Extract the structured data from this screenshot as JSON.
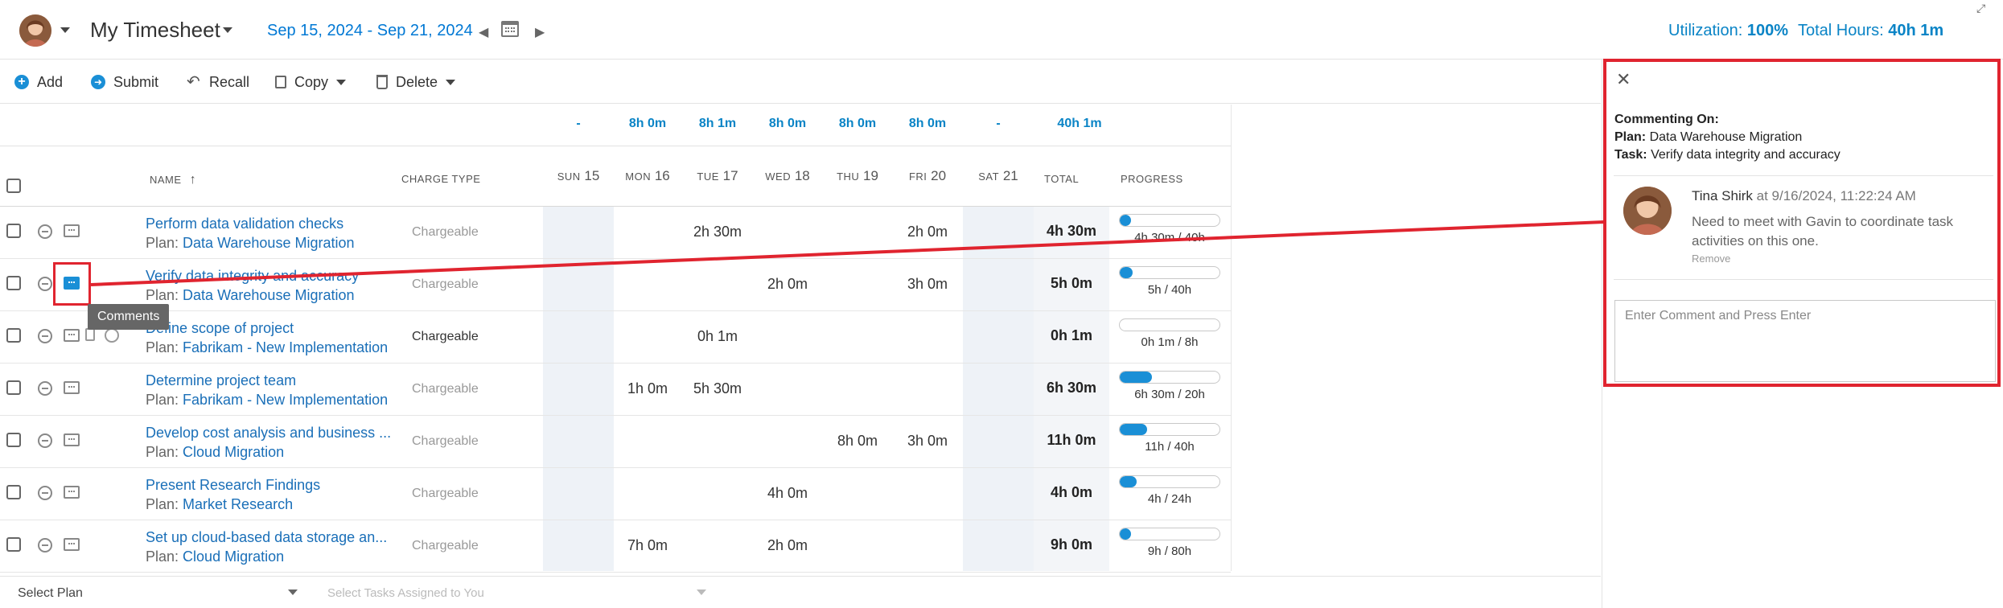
{
  "header": {
    "title": "My Timesheet",
    "date_range": "Sep 15, 2024 - Sep 21, 2024",
    "utilization_label": "Utilization:",
    "utilization_value": "100%",
    "total_hours_label": "Total Hours:",
    "total_hours_value": "40h 1m"
  },
  "toolbar": {
    "add": "Add",
    "submit": "Submit",
    "recall": "Recall",
    "copy": "Copy",
    "delete": "Delete"
  },
  "totals": {
    "sun": "-",
    "mon": "8h 0m",
    "tue": "8h 1m",
    "wed": "8h 0m",
    "thu": "8h 0m",
    "fri": "8h 0m",
    "sat": "-",
    "total": "40h 1m"
  },
  "columns": {
    "name": "NAME",
    "charge_type": "CHARGE TYPE",
    "sun": "SUN",
    "sun_n": "15",
    "mon": "MON",
    "mon_n": "16",
    "tue": "TUE",
    "tue_n": "17",
    "wed": "WED",
    "wed_n": "18",
    "thu": "THU",
    "thu_n": "19",
    "fri": "FRI",
    "fri_n": "20",
    "sat": "SAT",
    "sat_n": "21",
    "total": "TOTAL",
    "progress": "PROGRESS"
  },
  "rows": [
    {
      "name": "Perform data validation checks",
      "plan_label": "Plan:",
      "plan": "Data Warehouse Migration",
      "charge": "Chargeable",
      "sun": "",
      "mon": "",
      "tue": "2h 30m",
      "wed": "",
      "thu": "",
      "fri": "2h 0m",
      "sat": "",
      "total": "4h 30m",
      "progress": "4h 30m / 40h",
      "fraction": 0.11
    },
    {
      "name": "Verify data integrity and accuracy",
      "plan_label": "Plan:",
      "plan": "Data Warehouse Migration",
      "charge": "Chargeable",
      "sun": "",
      "mon": "",
      "tue": "",
      "wed": "2h 0m",
      "thu": "",
      "fri": "3h 0m",
      "sat": "",
      "total": "5h 0m",
      "progress": "5h / 40h",
      "fraction": 0.125
    },
    {
      "name": "Define scope of project",
      "plan_label": "Plan:",
      "plan": "Fabrikam - New Implementation",
      "charge": "Chargeable",
      "sun": "",
      "mon": "",
      "tue": "0h 1m",
      "wed": "",
      "thu": "",
      "fri": "",
      "sat": "",
      "total": "0h 1m",
      "progress": "0h 1m / 8h",
      "fraction": 0.0
    },
    {
      "name": "Determine project team",
      "plan_label": "Plan:",
      "plan": "Fabrikam - New Implementation",
      "charge": "Chargeable",
      "sun": "",
      "mon": "1h 0m",
      "tue": "5h 30m",
      "wed": "",
      "thu": "",
      "fri": "",
      "sat": "",
      "total": "6h 30m",
      "progress": "6h 30m / 20h",
      "fraction": 0.325
    },
    {
      "name": "Develop cost analysis and business ...",
      "plan_label": "Plan:",
      "plan": "Cloud Migration",
      "charge": "Chargeable",
      "sun": "",
      "mon": "",
      "tue": "",
      "wed": "",
      "thu": "8h 0m",
      "fri": "3h 0m",
      "sat": "",
      "total": "11h 0m",
      "progress": "11h / 40h",
      "fraction": 0.275
    },
    {
      "name": "Present Research Findings",
      "plan_label": "Plan:",
      "plan": "Market Research",
      "charge": "Chargeable",
      "sun": "",
      "mon": "",
      "tue": "",
      "wed": "4h 0m",
      "thu": "",
      "fri": "",
      "sat": "",
      "total": "4h 0m",
      "progress": "4h / 24h",
      "fraction": 0.167
    },
    {
      "name": "Set up cloud-based data storage an...",
      "plan_label": "Plan:",
      "plan": "Cloud Migration",
      "charge": "Chargeable",
      "sun": "",
      "mon": "7h 0m",
      "tue": "",
      "wed": "2h 0m",
      "thu": "",
      "fri": "",
      "sat": "",
      "total": "9h 0m",
      "progress": "9h / 80h",
      "fraction": 0.1125
    }
  ],
  "tooltip": "Comments",
  "footer": {
    "select_plan": "Select Plan",
    "select_tasks": "Select Tasks Assigned to You"
  },
  "comments_panel": {
    "commenting_on": "Commenting On:",
    "plan_label": "Plan:",
    "plan": "Data Warehouse Migration",
    "task_label": "Task:",
    "task": "Verify data integrity and accuracy",
    "author": "Tina Shirk",
    "timestamp": "at 9/16/2024, 11:22:24 AM",
    "text": "Need to meet with Gavin to coordinate task activities on this one.",
    "remove": "Remove",
    "input_placeholder": "Enter Comment and Press Enter"
  },
  "colors": {
    "accent": "#0a84c6",
    "highlight": "#e0242f",
    "progress": "#1a8fd6"
  }
}
